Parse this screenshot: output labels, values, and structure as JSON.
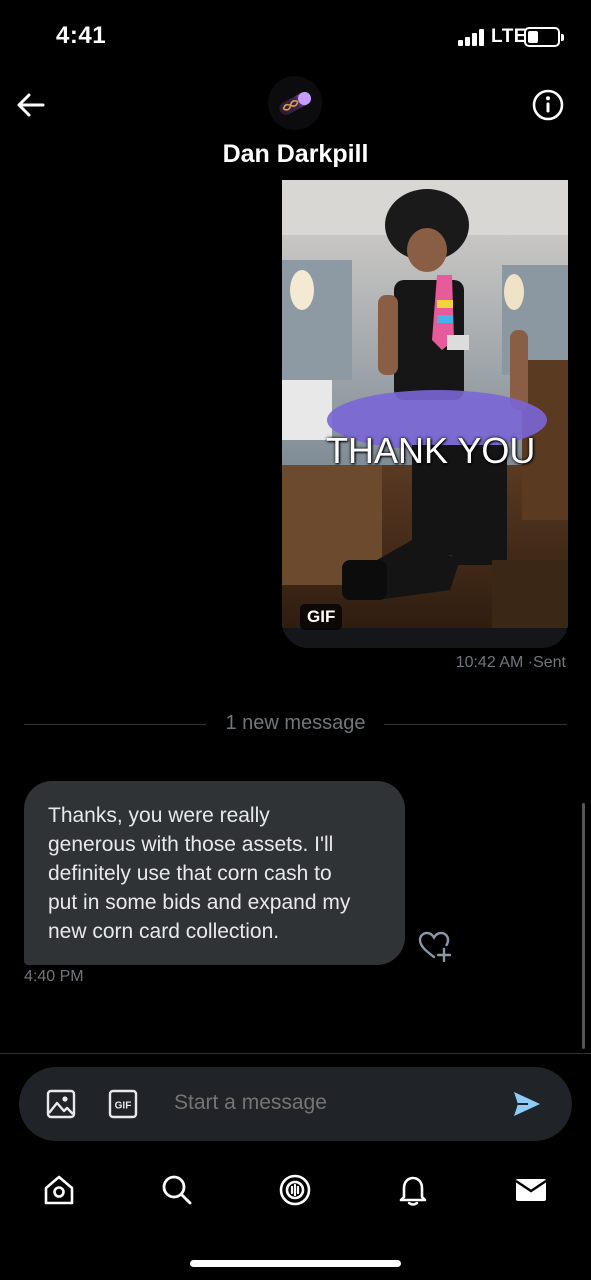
{
  "status_bar": {
    "time": "4:41",
    "network": "LTE",
    "signal_bars": 4,
    "battery_level": 0.35
  },
  "header": {
    "contact_name": "Dan Darkpill",
    "back_icon": "arrow-left-icon",
    "info_icon": "info-circle-icon"
  },
  "messages": {
    "sent": {
      "type": "gif",
      "badge": "GIF",
      "caption": "THANK YOU",
      "time": "10:42 AM",
      "status": "Sent"
    },
    "divider_text": "1 new message",
    "received": {
      "lines": [
        "Thanks, you were really",
        "generous with those assets. I'll",
        "definitely use that corn cash to",
        "put in some bids and expand my",
        "new corn card collection."
      ],
      "time": "4:40 PM",
      "react_icon": "heart-plus-icon"
    }
  },
  "composer": {
    "placeholder": "Start a message",
    "image_icon": "image-icon",
    "gif_icon": "gif-icon",
    "gif_icon_text": "GIF",
    "send_icon": "send-icon"
  },
  "tabbar": {
    "items": [
      {
        "icon": "home-icon"
      },
      {
        "icon": "search-icon"
      },
      {
        "icon": "spaces-icon"
      },
      {
        "icon": "bell-icon"
      },
      {
        "icon": "mail-icon",
        "active": true
      }
    ]
  },
  "colors": {
    "background": "#000000",
    "bubble_received": "#2f3336",
    "muted_text": "#71767b",
    "accent": "#1d9bf0"
  }
}
